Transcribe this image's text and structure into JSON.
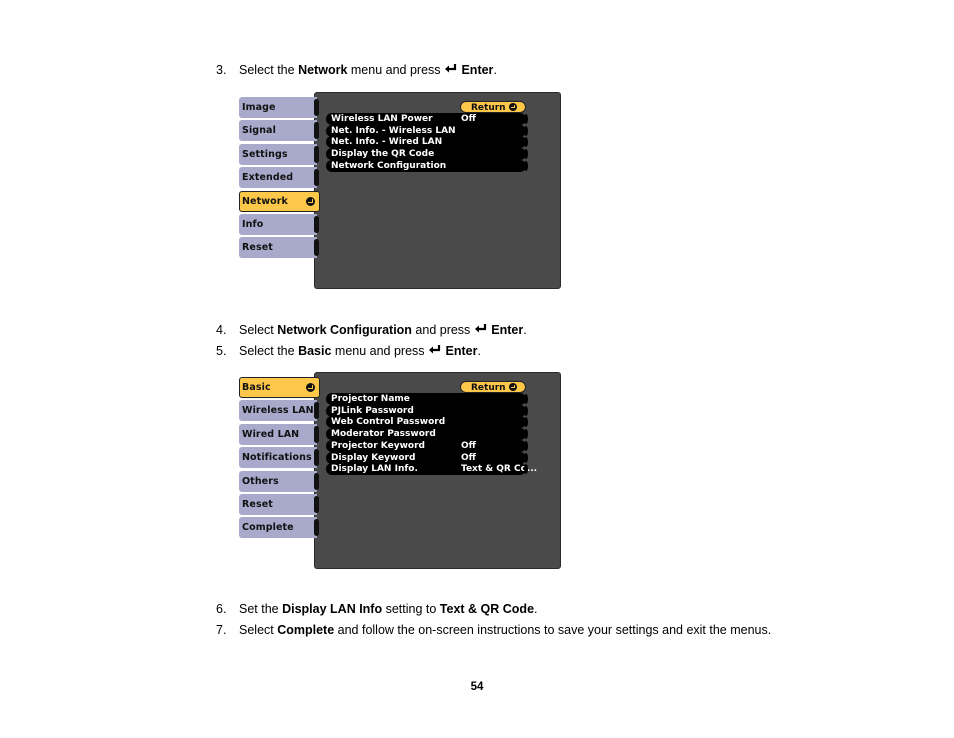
{
  "steps": [
    {
      "number": "3.",
      "parts": [
        {
          "text": "Select the ",
          "bold": false
        },
        {
          "text": "Network",
          "bold": true
        },
        {
          "text": " menu and press ",
          "bold": false
        },
        {
          "icon": "enter-icon"
        },
        {
          "text": " Enter",
          "bold": true
        },
        {
          "text": ".",
          "bold": false
        }
      ]
    },
    {
      "number": "4.",
      "parts": [
        {
          "text": "Select ",
          "bold": false
        },
        {
          "text": "Network Configuration",
          "bold": true
        },
        {
          "text": " and press ",
          "bold": false
        },
        {
          "icon": "enter-icon"
        },
        {
          "text": " Enter",
          "bold": true
        },
        {
          "text": ".",
          "bold": false
        }
      ]
    },
    {
      "number": "5.",
      "parts": [
        {
          "text": "Select the ",
          "bold": false
        },
        {
          "text": "Basic",
          "bold": true
        },
        {
          "text": " menu and press ",
          "bold": false
        },
        {
          "icon": "enter-icon"
        },
        {
          "text": " Enter",
          "bold": true
        },
        {
          "text": ".",
          "bold": false
        }
      ]
    },
    {
      "number": "6.",
      "parts": [
        {
          "text": "Set the ",
          "bold": false
        },
        {
          "text": "Display LAN Info",
          "bold": true
        },
        {
          "text": " setting to ",
          "bold": false
        },
        {
          "text": "Text & QR Code",
          "bold": true
        },
        {
          "text": ".",
          "bold": false
        }
      ]
    },
    {
      "number": "7.",
      "parts": [
        {
          "text": "Select ",
          "bold": false
        },
        {
          "text": "Complete",
          "bold": true
        },
        {
          "text": " and follow the on-screen instructions to save your settings and exit the menus.",
          "bold": false
        }
      ]
    }
  ],
  "menu1": {
    "return_label": "Return",
    "tabs": [
      {
        "label": "Image",
        "selected": false
      },
      {
        "label": "Signal",
        "selected": false
      },
      {
        "label": "Settings",
        "selected": false
      },
      {
        "label": "Extended",
        "selected": false
      },
      {
        "label": "Network",
        "selected": true
      },
      {
        "label": "Info",
        "selected": false
      },
      {
        "label": "Reset",
        "selected": false
      }
    ],
    "items": [
      {
        "label": "Wireless LAN Power",
        "value": "Off"
      },
      {
        "label": "Net. Info. - Wireless LAN",
        "value": ""
      },
      {
        "label": "Net. Info. - Wired LAN",
        "value": ""
      },
      {
        "label": "Display the QR Code",
        "value": ""
      },
      {
        "label": "Network Configuration",
        "value": ""
      }
    ]
  },
  "menu2": {
    "return_label": "Return",
    "tabs": [
      {
        "label": "Basic",
        "selected": true
      },
      {
        "label": "Wireless LAN",
        "selected": false
      },
      {
        "label": "Wired LAN",
        "selected": false
      },
      {
        "label": "Notifications",
        "selected": false
      },
      {
        "label": "Others",
        "selected": false
      },
      {
        "label": "Reset",
        "selected": false
      },
      {
        "label": "Complete",
        "selected": false
      }
    ],
    "items": [
      {
        "label": "Projector Name",
        "value": ""
      },
      {
        "label": "PJLink Password",
        "value": ""
      },
      {
        "label": "Web Control Password",
        "value": ""
      },
      {
        "label": "Moderator Password",
        "value": ""
      },
      {
        "label": "Projector Keyword",
        "value": "Off"
      },
      {
        "label": "Display Keyword",
        "value": "Off"
      },
      {
        "label": "Display LAN Info.",
        "value": "Text & QR Co..."
      }
    ]
  },
  "page_number": "54",
  "colors": {
    "tab_normal": "#a9a9cc",
    "tab_selected": "#fdc84a",
    "panel": "#4a4a4a",
    "item_bg": "#000000"
  }
}
